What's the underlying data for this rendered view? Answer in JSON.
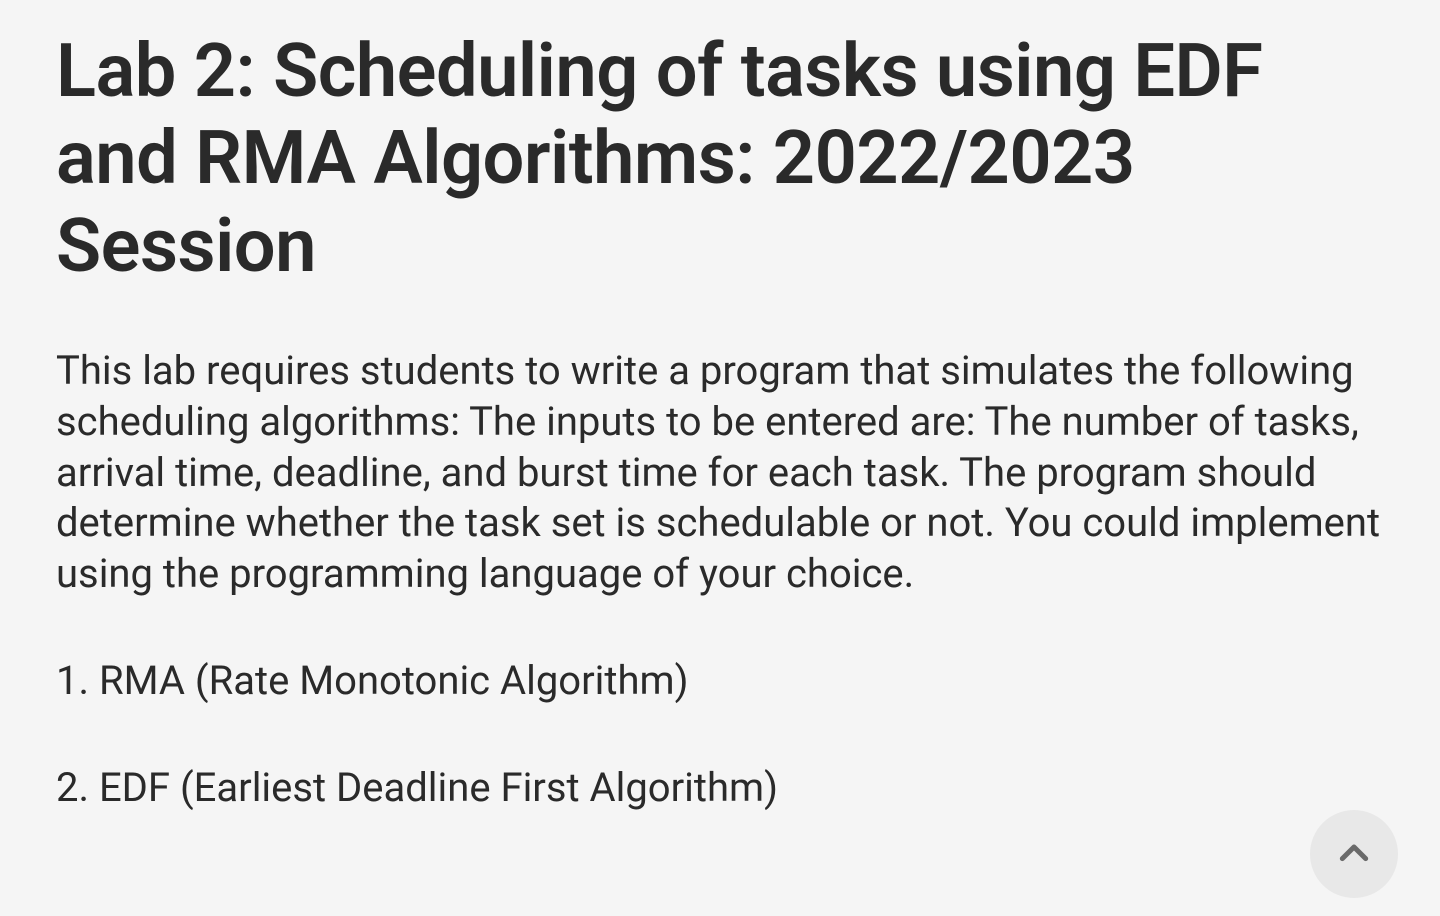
{
  "title": "Lab 2: Scheduling of tasks using EDF and RMA Algorithms: 2022/2023 Session",
  "description": "This lab requires students to write a program that simulates the following scheduling algorithms: The inputs to be entered are: The number of tasks, arrival time, deadline, and burst time for each task. The program should determine whether the task set is schedulable or not. You could implement using the programming language of your choice.",
  "items": [
    "1. RMA (Rate Monotonic Algorithm)",
    "2. EDF (Earliest Deadline First Algorithm)"
  ]
}
